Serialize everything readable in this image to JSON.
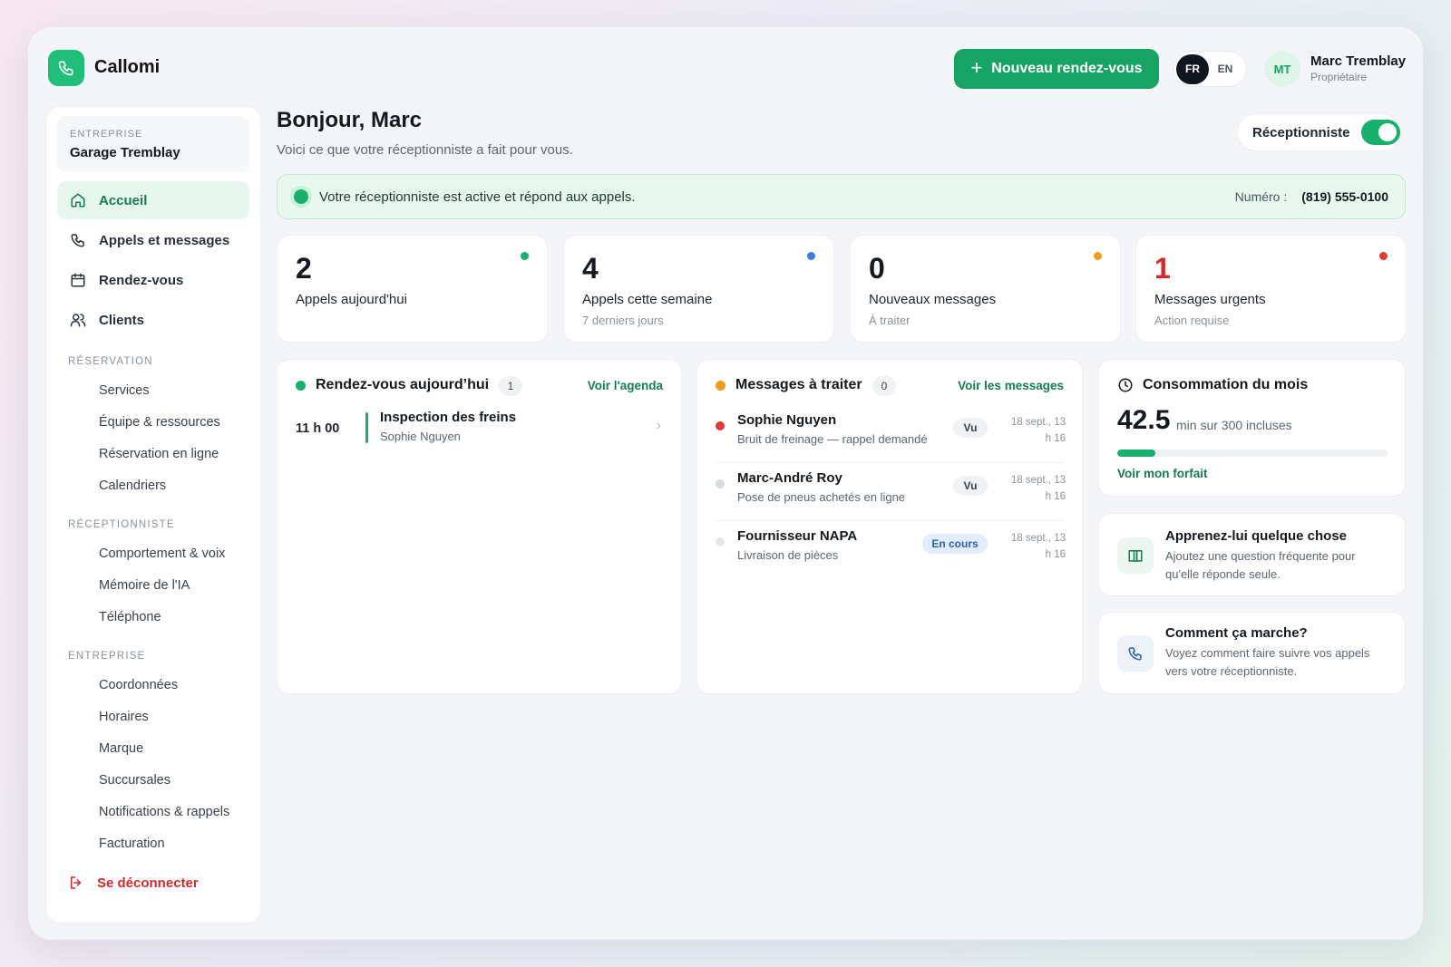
{
  "app": {
    "name": "Callomi"
  },
  "header": {
    "new_button": "Nouveau rendez-vous",
    "lang_active": "FR",
    "lang_other": "EN",
    "user_initials": "MT",
    "user_name": "Marc Tremblay",
    "user_role": "Propriétaire"
  },
  "sidebar": {
    "company_label": "ENTREPRISE",
    "company_name": "Garage Tremblay",
    "main_items": [
      {
        "label": "Accueil",
        "icon": "home-icon"
      },
      {
        "label": "Appels et messages",
        "icon": "phone-icon"
      },
      {
        "label": "Rendez-vous",
        "icon": "calendar-icon"
      },
      {
        "label": "Clients",
        "icon": "users-icon"
      }
    ],
    "sections": [
      {
        "title": "RÉSERVATION",
        "items": [
          "Services",
          "Équipe & ressources",
          "Réservation en ligne",
          "Calendriers"
        ]
      },
      {
        "title": "RÉCEPTIONNISTE",
        "items": [
          "Comportement & voix",
          "Mémoire de l'IA",
          "Téléphone"
        ]
      },
      {
        "title": "ENTREPRISE",
        "items": [
          "Coordonnées",
          "Horaires",
          "Marque",
          "Succursales",
          "Notifications & rappels",
          "Facturation"
        ]
      }
    ],
    "logout": "Se déconnecter"
  },
  "main": {
    "greeting": "Bonjour, Marc",
    "subtitle": "Voici ce que votre réceptionniste a fait pour vous.",
    "toggle_label": "Réceptionniste",
    "toggle_on": true,
    "status_text": "Votre réceptionniste est active et répond aux appels.",
    "number_label": "Numéro :",
    "number_value": "(819) 555-0100"
  },
  "stats": [
    {
      "value": "2",
      "label": "Appels aujourd'hui",
      "sub": "",
      "color": "#19b06d",
      "value_color": "#14181f"
    },
    {
      "value": "4",
      "label": "Appels cette semaine",
      "sub": "7 derniers jours",
      "color": "#3b7be6",
      "value_color": "#14181f"
    },
    {
      "value": "0",
      "label": "Nouveaux messages",
      "sub": "À traiter",
      "color": "#f29b1d",
      "value_color": "#14181f"
    },
    {
      "value": "1",
      "label": "Messages urgents",
      "sub": "Action requise",
      "color": "#e03a3a",
      "value_color": "#d12a2a"
    }
  ],
  "appointments": {
    "title": "Rendez-vous aujourd’hui",
    "count": "1",
    "link": "Voir l'agenda",
    "items": [
      {
        "time": "11 h 00",
        "title": "Inspection des freins",
        "client": "Sophie Nguyen"
      }
    ]
  },
  "messages": {
    "title": "Messages à traiter",
    "count": "0",
    "link": "Voir les messages",
    "items": [
      {
        "name": "Sophie Nguyen",
        "text": "Bruit de freinage — rappel demandé",
        "tag": "Vu",
        "time_line1": "18 sept., 13",
        "time_line2": "h 16",
        "dot": "#e03a3a"
      },
      {
        "name": "Marc-André Roy",
        "text": "Pose de pneus achetés en ligne",
        "tag": "Vu",
        "time_line1": "18 sept., 13",
        "time_line2": "h 16",
        "dot": "#d7dbe2"
      },
      {
        "name": "Fournisseur NAPA",
        "text": "Livraison de pièces",
        "tag": "En cours",
        "time_line1": "18 sept., 13",
        "time_line2": "h 16",
        "dot": "#e3e6eb"
      }
    ]
  },
  "usage": {
    "title": "Consommation du mois",
    "minutes": "42.5",
    "caption": "min sur 300 incluses",
    "used_fraction": 0.1417,
    "link": "Voir mon forfait"
  },
  "tips": [
    {
      "title": "Apprenez-lui quelque chose",
      "text": "Ajoutez une question fréquente pour qu'elle réponde seule.",
      "icon": "book-icon"
    },
    {
      "title": "Comment ça marche?",
      "text": "Voyez comment faire suivre vos appels vers votre réceptionniste.",
      "icon": "phone-icon"
    }
  ]
}
